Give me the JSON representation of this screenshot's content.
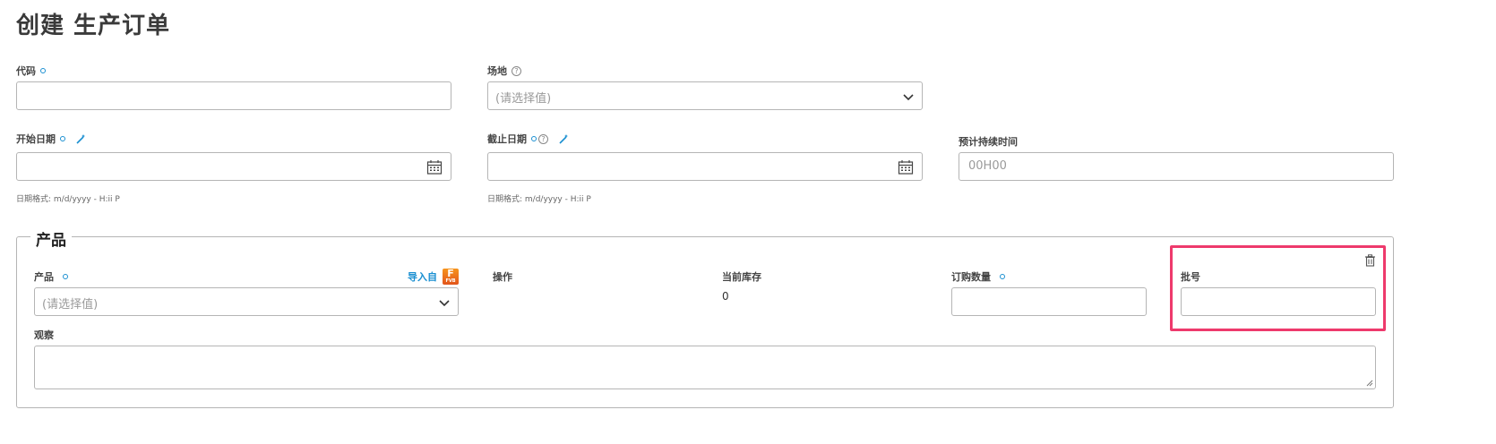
{
  "page": {
    "title": "创建 生产订单"
  },
  "fields": {
    "code": {
      "label": "代码",
      "value": ""
    },
    "site": {
      "label": "场地",
      "placeholder": "(请选择值)"
    },
    "start_date": {
      "label": "开始日期",
      "value": "",
      "hint": "日期格式: m/d/yyyy - H:ii P"
    },
    "end_date": {
      "label": "截止日期",
      "value": "",
      "hint": "日期格式: m/d/yyyy - H:ii P"
    },
    "duration": {
      "label": "预计持续时间",
      "placeholder": "00H00"
    }
  },
  "products": {
    "legend": "产品",
    "product": {
      "label": "产品",
      "placeholder": "(请选择值)"
    },
    "import_label": "导入自",
    "import_badge": "F",
    "import_badge_sub": "FVB",
    "action_label": "操作",
    "stock_label": "当前库存",
    "stock_value": "0",
    "qty": {
      "label": "订购数量",
      "value": ""
    },
    "batch": {
      "label": "批号",
      "value": ""
    },
    "notes": {
      "label": "观察",
      "value": ""
    }
  },
  "colors": {
    "accent": "#1a8fd1",
    "highlight": "#ee3a6c",
    "badge": "#f7941d"
  },
  "icons": [
    "help-icon",
    "wand-icon",
    "chevron-down-icon",
    "calendar-icon",
    "trash-icon",
    "resize-handle-icon"
  ]
}
